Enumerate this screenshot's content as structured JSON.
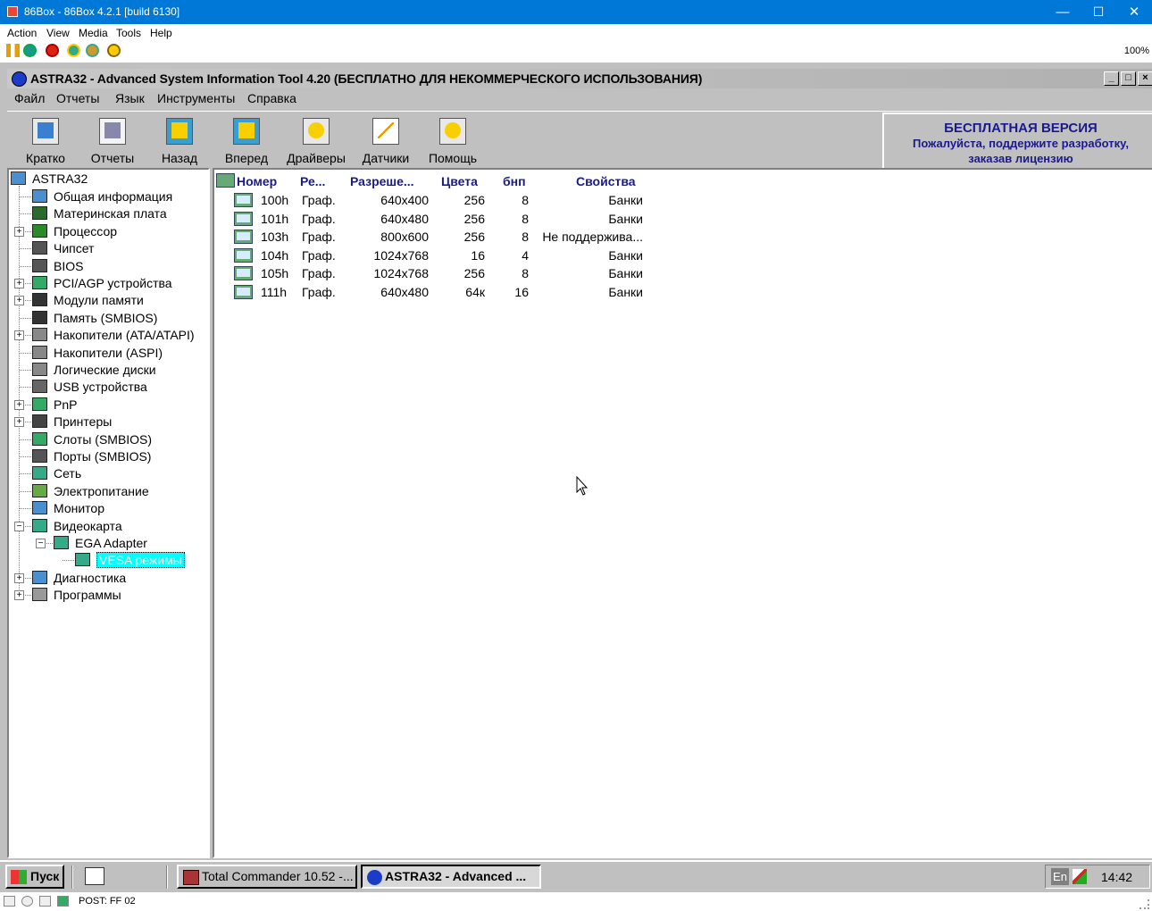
{
  "window": {
    "title": "86Box - 86Box 4.2.1 [build 6130]",
    "minimize": "—",
    "maximize": "☐",
    "close": "✕"
  },
  "menu86": [
    "Action",
    "View",
    "Media",
    "Tools",
    "Help"
  ],
  "zoom": "100%",
  "astra": {
    "title": "ASTRA32 - Advanced System Information Tool 4.20 (БЕСПЛАТНО ДЛЯ НЕКОММЕРЧЕСКОГО ИСПОЛЬЗОВАНИЯ)",
    "menu": [
      "Файл",
      "Отчеты",
      "Язык",
      "Инструменты",
      "Справка"
    ],
    "toolbar": [
      "Кратко",
      "Отчеты",
      "Назад",
      "Вперед",
      "Драйверы",
      "Датчики",
      "Помощь"
    ],
    "promo": {
      "line1": "БЕСПЛАТНАЯ ВЕРСИЯ",
      "line2": "Пожалуйста, поддержите разработку,",
      "line3": "заказав лицензию"
    }
  },
  "tree": {
    "root": "ASTRA32",
    "items": [
      "Общая информация",
      "Материнская плата",
      "Процессор",
      "Чипсет",
      "BIOS",
      "PCI/AGP устройства",
      "Модули памяти",
      "Память (SMBIOS)",
      "Накопители (ATA/ATAPI)",
      "Накопители (ASPI)",
      "Логические диски",
      "USB устройства",
      "PnP",
      "Принтеры",
      "Слоты (SMBIOS)",
      "Порты (SMBIOS)",
      "Сеть",
      "Электропитание",
      "Монитор",
      "Видеокарта",
      "EGA Adapter",
      "VESA режимы",
      "Диагностика",
      "Программы"
    ]
  },
  "table": {
    "headers": [
      "Номер",
      "Ре...",
      "Разреше...",
      "Цвета",
      "бнп",
      "Свойства"
    ],
    "rows": [
      [
        "100h",
        "Граф.",
        "640x400",
        "256",
        "8",
        "Банки"
      ],
      [
        "101h",
        "Граф.",
        "640x480",
        "256",
        "8",
        "Банки"
      ],
      [
        "103h",
        "Граф.",
        "800x600",
        "256",
        "8",
        "Не поддержива..."
      ],
      [
        "104h",
        "Граф.",
        "1024x768",
        "16",
        "4",
        "Банки"
      ],
      [
        "105h",
        "Граф.",
        "1024x768",
        "256",
        "8",
        "Банки"
      ],
      [
        "111h",
        "Граф.",
        "640x480",
        "64к",
        "16",
        "Банки"
      ]
    ]
  },
  "taskbar": {
    "start": "Пуск",
    "tasks": [
      "Total Commander 10.52 -...",
      "ASTRA32 - Advanced ..."
    ],
    "lang": "En",
    "clock": "14:42"
  },
  "status86": "POST: FF 02"
}
